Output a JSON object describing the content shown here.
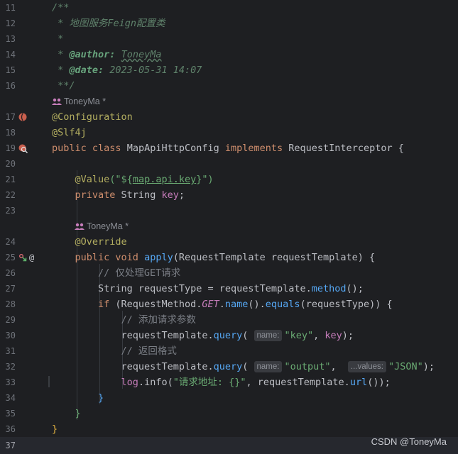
{
  "editor": {
    "line_numbers": [
      "11",
      "12",
      "13",
      "14",
      "15",
      "16",
      "17",
      "18",
      "19",
      "20",
      "21",
      "22",
      "23",
      "24",
      "25",
      "26",
      "27",
      "28",
      "29",
      "30",
      "31",
      "32",
      "33",
      "34",
      "35",
      "36",
      "37"
    ],
    "author_hint": "ToneyMa *",
    "doc": {
      "open": "/**",
      "line1": " * 地图服务Feign配置类",
      "star": " *",
      "author_prefix": " * ",
      "author_tag": "@author:",
      "author_value": "ToneyMa",
      "date_prefix": " * ",
      "date_tag": "@date:",
      "date_value": " 2023-05-31 14:07",
      "close": " **/"
    },
    "code": {
      "annotation_configuration": "@Configuration",
      "annotation_slf4j": "@Slf4j",
      "kw_public": "public",
      "kw_class": "class",
      "class_name": " MapApiHttpConfig ",
      "kw_implements": "implements",
      "interface_name": " RequestInterceptor {",
      "annotation_value": "@Value",
      "value_open": "(\"${",
      "value_key": "map.api.key",
      "value_close": "}\")",
      "kw_private": "private",
      "field_type": " String ",
      "field_name": "key",
      "semicolon": ";",
      "annotation_override": "@Override",
      "kw_void": " void ",
      "method_name": "apply",
      "method_params": "(RequestTemplate requestTemplate) {",
      "comment_filter_get": "// 仅处理GET请求",
      "line27_a": "String requestType = requestTemplate.",
      "line27_b": "method",
      "line27_c": "();",
      "kw_if": "if",
      "line28_a": " (RequestMethod.",
      "line28_get": "GET",
      "line28_b": ".",
      "line28_name": "name",
      "line28_c": "().",
      "line28_equals": "equals",
      "line28_d": "(requestType)) {",
      "comment_add_params": "// 添加请求参数",
      "query_prefix": "requestTemplate.",
      "query_method": "query",
      "paren_open": "(",
      "hint_name": "name:",
      "query1_key": "\"key\"",
      "comma": ", ",
      "query1_val": "key",
      "close_stmt": ");",
      "comment_format": "// 返回格式",
      "query2_key": "\"output\"",
      "hint_values": "...values:",
      "query2_val": "\"JSON\"",
      "log_var": "log",
      "log_info": ".info(",
      "log_msg": "\"请求地址: {}\"",
      "log_rest_a": ", requestTemplate.",
      "log_url": "url",
      "log_rest_b": "());",
      "brace_close": "}"
    }
  },
  "watermark": "CSDN @ToneyMa",
  "colors": {
    "background": "#1e1f22",
    "keyword": "#cf8e6d",
    "annotation": "#b3ae60",
    "string": "#6aab73",
    "method": "#56a8f5",
    "field": "#c77dbb",
    "comment": "#7a7e85",
    "doc_comment": "#5f826b"
  },
  "icons": [
    "bean-icon",
    "bean-search-icon",
    "implemented-method-icon",
    "at-sign-icon",
    "people-icon"
  ]
}
